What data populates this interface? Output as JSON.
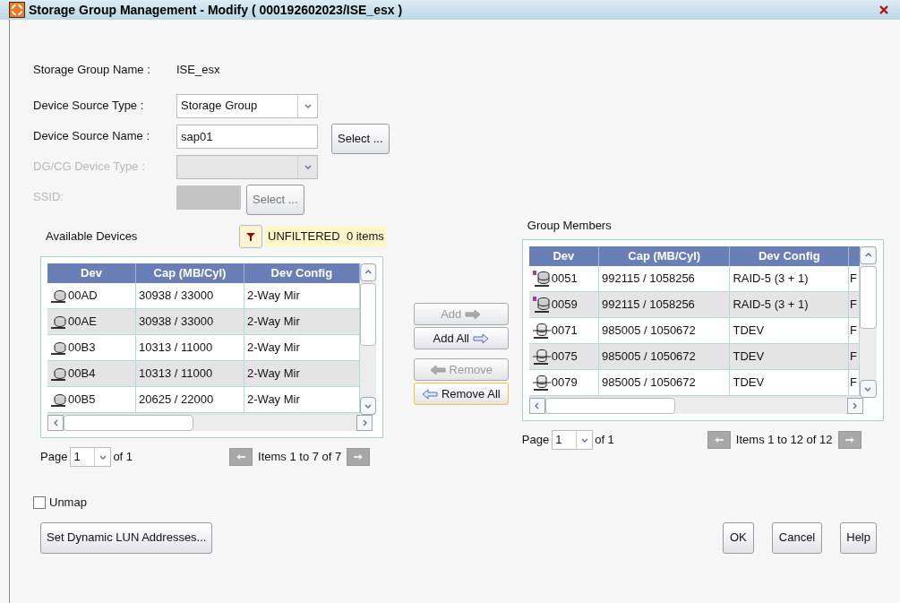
{
  "window": {
    "title": "Storage Group Management - Modify ( 000192602023/ISE_esx )"
  },
  "storage_group_name": {
    "label": "Storage Group Name :",
    "value": "ISE_esx"
  },
  "form": [
    {
      "kind": "combo",
      "label": "Device Source Type :",
      "value": "Storage Group",
      "disabled": false
    },
    {
      "kind": "text",
      "label": "Device Source Name :",
      "value": "sap01",
      "disabled": false,
      "button": "Select ..."
    },
    {
      "kind": "combo",
      "label": "DG/CG Device Type :",
      "disabled": true
    },
    {
      "kind": "swatch",
      "label": "SSID:",
      "disabled": true,
      "button": "Select ..."
    }
  ],
  "available": {
    "title": "Available Devices",
    "filter_status": "UNFILTERED",
    "filter_count": "0 items",
    "columns": [
      "Dev",
      "Cap (MB/Cyl)",
      "Dev Config"
    ],
    "rows": [
      {
        "kind": "disk",
        "cells": [
          "00AD",
          "30938 / 33000",
          "2-Way Mir"
        ]
      },
      {
        "kind": "disk",
        "cells": [
          "00AE",
          "30938 / 33000",
          "2-Way Mir"
        ]
      },
      {
        "kind": "disk",
        "cells": [
          "00B3",
          "10313 / 11000",
          "2-Way Mir"
        ]
      },
      {
        "kind": "disk",
        "cells": [
          "00B4",
          "10313 / 11000",
          "2-Way Mir"
        ]
      },
      {
        "kind": "disk",
        "cells": [
          "00B5",
          "20625 / 22000",
          "2-Way Mir"
        ]
      }
    ],
    "pager": {
      "page_label": "Page",
      "page": "1",
      "of": "of 1",
      "items": "Items 1 to 7 of 7"
    }
  },
  "transfer_buttons": [
    {
      "label": "Add",
      "kind": "forward",
      "disabled": true,
      "focused": false
    },
    {
      "label": "Add All",
      "kind": "forward",
      "disabled": false,
      "focused": false
    },
    {
      "label": "Remove",
      "kind": "back",
      "disabled": true,
      "focused": false
    },
    {
      "label": "Remove All",
      "kind": "back",
      "disabled": false,
      "focused": true
    }
  ],
  "members": {
    "title": "Group Members",
    "columns": [
      "Dev",
      "Cap (MB/Cyl)",
      "Dev Config"
    ],
    "rows": [
      {
        "kind": "meta",
        "cells": [
          "0051",
          "992115 / 1058256",
          "RAID-5 (3 + 1)",
          "F"
        ]
      },
      {
        "kind": "meta",
        "cells": [
          "0059",
          "992115 / 1058256",
          "RAID-5 (3 + 1)",
          "F"
        ]
      },
      {
        "kind": "thin",
        "cells": [
          "0071",
          "985005 / 1050672",
          "TDEV",
          "F"
        ]
      },
      {
        "kind": "thin",
        "cells": [
          "0075",
          "985005 / 1050672",
          "TDEV",
          "F"
        ]
      },
      {
        "kind": "thin",
        "cells": [
          "0079",
          "985005 / 1050672",
          "TDEV",
          "F"
        ]
      }
    ],
    "pager": {
      "page_label": "Page",
      "page": "1",
      "of": "of 1",
      "items": "Items 1 to 12 of 12"
    }
  },
  "unmap": {
    "label": "Unmap",
    "checked": false
  },
  "buttons": {
    "lun": "Set Dynamic LUN Addresses...",
    "ok": "OK",
    "cancel": "Cancel",
    "help": "Help"
  }
}
